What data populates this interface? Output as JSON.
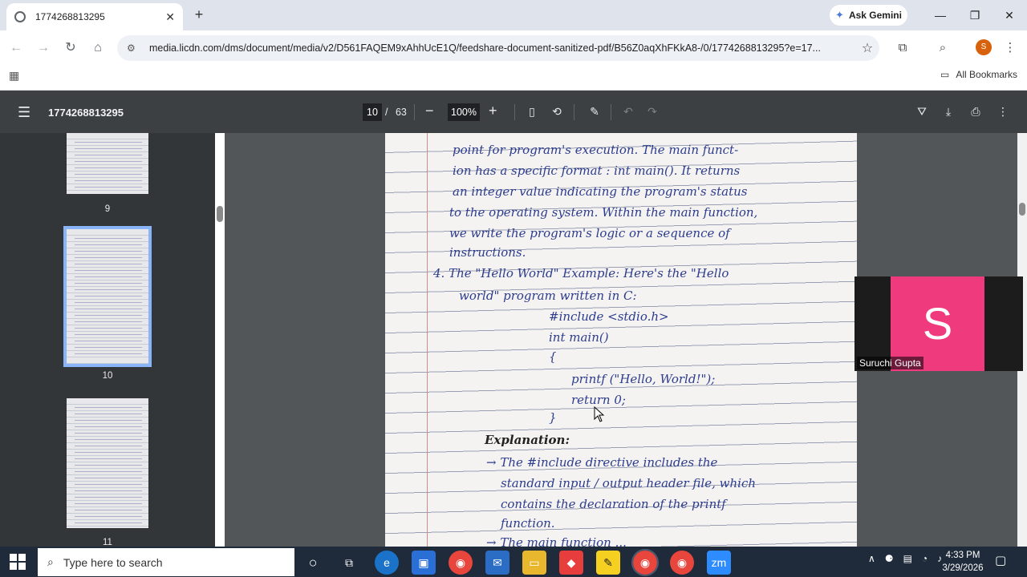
{
  "browser": {
    "tab_title": "1774268813295",
    "url": "media.licdn.com/dms/document/media/v2/D561FAQEM9xAhhUcE1Q/feedshare-document-sanitized-pdf/B56Z0aqXhFKkA8-/0/1774268813295?e=17...",
    "gemini_label": "Ask Gemini",
    "profile_initial": "S",
    "all_bookmarks_label": "All Bookmarks"
  },
  "pdf": {
    "title": "1774268813295",
    "current_page": "10",
    "page_separator": "/",
    "total_pages": "63",
    "zoom": "100%"
  },
  "thumbnails": [
    {
      "label": "9"
    },
    {
      "label": "10"
    },
    {
      "label": "11"
    }
  ],
  "page_text": [
    "point  for  program's  execution. The  main  funct-",
    "ion   has  a  specific  format :  int  main(). It  returns",
    "an  integer  value  indicating  the  program's  status",
    "to  the  operating  system. Within  the  main  function,",
    "we  write  the  program's  logic  or  a  sequence  of",
    "instructions.",
    "4.  The  \"Hello  World\"  Example:  Here's  the  \"Hello",
    "world\"  program  written   in  C:",
    "#include <stdio.h>",
    "int main()",
    "{",
    "printf (\"Hello, World!\");",
    "return 0;",
    "}",
    "Explanation:",
    "→ The  #include  directive  includes  the",
    "standard  input / output  header  file, which",
    "contains  the  declaration  of  the  printf",
    "function.",
    "→ The  main  function ..."
  ],
  "video_tile": {
    "initial": "S",
    "name": "Suruchi Gupta"
  },
  "taskbar": {
    "search_placeholder": "Type here to search",
    "time": "4:33 PM",
    "date": "3/29/2026"
  }
}
